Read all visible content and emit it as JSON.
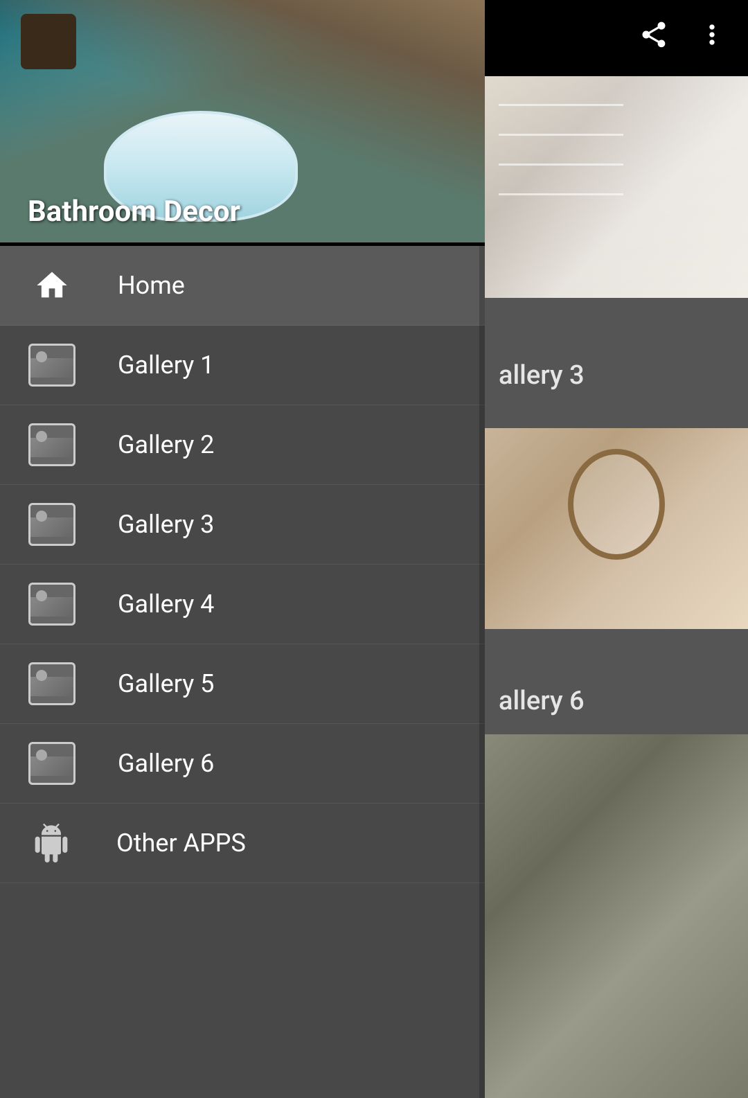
{
  "app": {
    "title": "Bathroom Decor"
  },
  "topbar": {
    "share_icon": "share",
    "more_icon": "more_vert"
  },
  "hero": {
    "title": "Bathroom Decor"
  },
  "right_labels": {
    "gallery3_partial": "allery 3",
    "gallery6_partial": "allery 6"
  },
  "nav": {
    "items": [
      {
        "id": "home",
        "label": "Home",
        "icon": "home"
      },
      {
        "id": "gallery1",
        "label": "Gallery 1",
        "icon": "image"
      },
      {
        "id": "gallery2",
        "label": "Gallery 2",
        "icon": "image"
      },
      {
        "id": "gallery3",
        "label": "Gallery 3",
        "icon": "image"
      },
      {
        "id": "gallery4",
        "label": "Gallery 4",
        "icon": "image"
      },
      {
        "id": "gallery5",
        "label": "Gallery 5",
        "icon": "image"
      },
      {
        "id": "gallery6",
        "label": "Gallery 6",
        "icon": "image"
      },
      {
        "id": "other_apps",
        "label": "Other APPS",
        "icon": "android"
      }
    ]
  }
}
